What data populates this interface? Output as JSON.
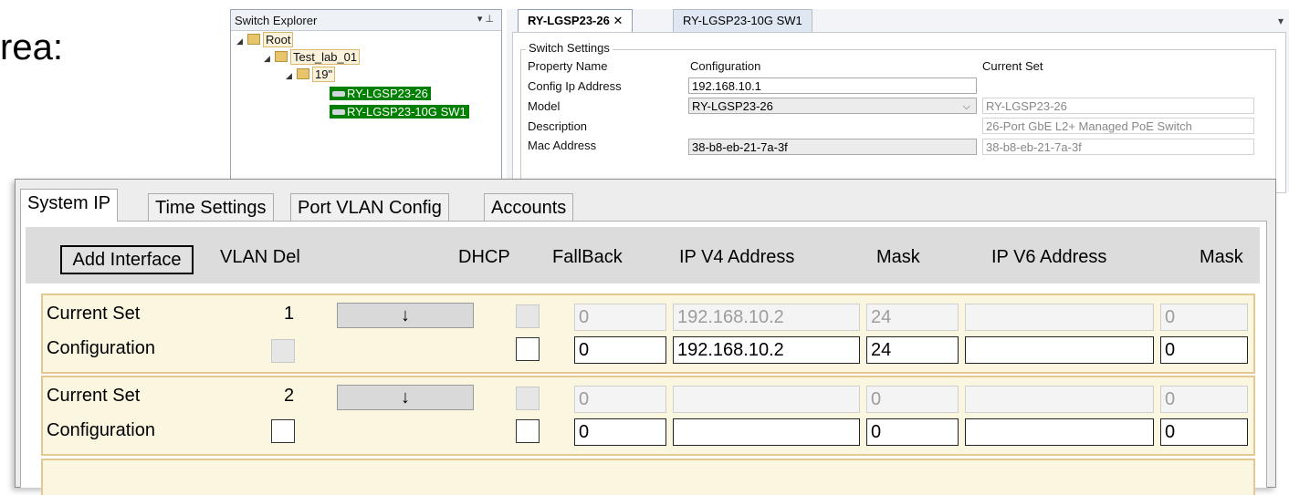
{
  "slide": {
    "text": "rea:"
  },
  "explorer": {
    "title": "Switch Explorer",
    "header_buttons": "▾ ⊥",
    "tree": [
      {
        "label": "Root"
      },
      {
        "label": "Test_lab_01"
      },
      {
        "label": "19\""
      },
      {
        "label": "RY-LGSP23-26"
      },
      {
        "label": "RY-LGSP23-10G SW1"
      }
    ]
  },
  "doc_tabs": [
    {
      "label": "RY-LGSP23-26",
      "close": "✕"
    },
    {
      "label": "RY-LGSP23-10G SW1"
    }
  ],
  "switch_settings": {
    "legend": "Switch Settings",
    "headers": {
      "property": "Property Name",
      "configuration": "Configuration",
      "current": "Current Set"
    },
    "rows": [
      {
        "name": "Config Ip Address",
        "config": "192.168.10.1",
        "current": ""
      },
      {
        "name": "Model",
        "config": "RY-LGSP23-26",
        "current": "RY-LGSP23-26"
      },
      {
        "name": "Description",
        "config": "",
        "current": "26-Port GbE L2+ Managed PoE Switch"
      },
      {
        "name": "Mac Address",
        "config": "38-b8-eb-21-7a-3f",
        "current": "38-b8-eb-21-7a-3f"
      }
    ]
  },
  "dialog": {
    "tabs": [
      "System IP",
      "Time Settings",
      "Port VLAN Config",
      "Accounts"
    ],
    "add_button": "Add Interface",
    "headers": [
      "VLAN Del",
      "DHCP",
      "FallBack",
      "IP V4 Address",
      "Mask",
      "IP V6 Address",
      "Mask"
    ],
    "arrow_symbol": "↓",
    "interfaces": [
      {
        "vlan": "1",
        "current": {
          "label": "Current Set",
          "fallback": "0",
          "ipv4": "192.168.10.2",
          "mask": "24",
          "ipv6": "",
          "mask6": "0"
        },
        "config": {
          "label": "Configuration",
          "fallback": "0",
          "ipv4": "192.168.10.2",
          "mask": "24",
          "ipv6": "",
          "mask6": "0"
        }
      },
      {
        "vlan": "2",
        "current": {
          "label": "Current Set",
          "fallback": "0",
          "ipv4": "",
          "mask": "0",
          "ipv6": "",
          "mask6": "0"
        },
        "config": {
          "label": "Configuration",
          "fallback": "0",
          "ipv4": "",
          "mask": "0",
          "ipv6": "",
          "mask6": "0"
        }
      }
    ]
  }
}
